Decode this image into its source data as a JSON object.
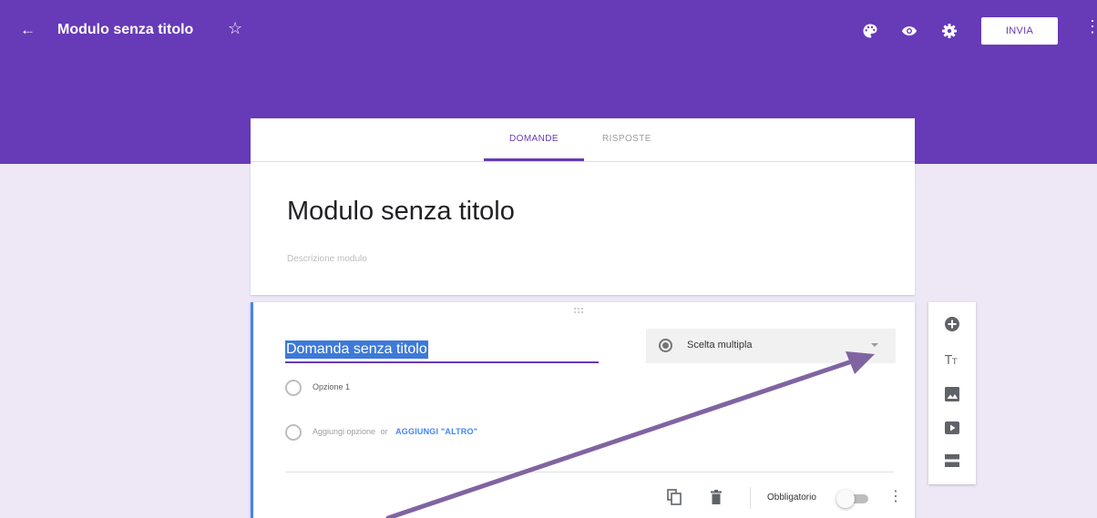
{
  "topbar": {
    "form_name": "Modulo senza titolo",
    "send_label": "INVIA",
    "color": "#673ab7",
    "icons": [
      "back-arrow-icon",
      "star-icon",
      "palette-icon",
      "eye-icon",
      "gear-icon",
      "more-vertical-icon"
    ]
  },
  "tabs": [
    {
      "label": "DOMANDE",
      "active": true
    },
    {
      "label": "RISPOSTE",
      "active": false
    }
  ],
  "form": {
    "title": "Modulo senza titolo",
    "description_placeholder": "Descrizione modulo"
  },
  "question": {
    "title": "Domanda senza titolo",
    "type": "Scelta multipla",
    "options": [
      "Opzione 1"
    ],
    "add_option": "Aggiungi opzione",
    "or": "or",
    "add_other": "AGGIUNGI \"ALTRO\"",
    "required_label": "Obbligatorio",
    "required": false
  },
  "side_toolbar": {
    "icons": [
      "add-question-icon",
      "add-title-icon",
      "add-image-icon",
      "add-video-icon",
      "add-section-icon"
    ]
  },
  "annotation": {
    "arrow_color": "#8064a2"
  }
}
